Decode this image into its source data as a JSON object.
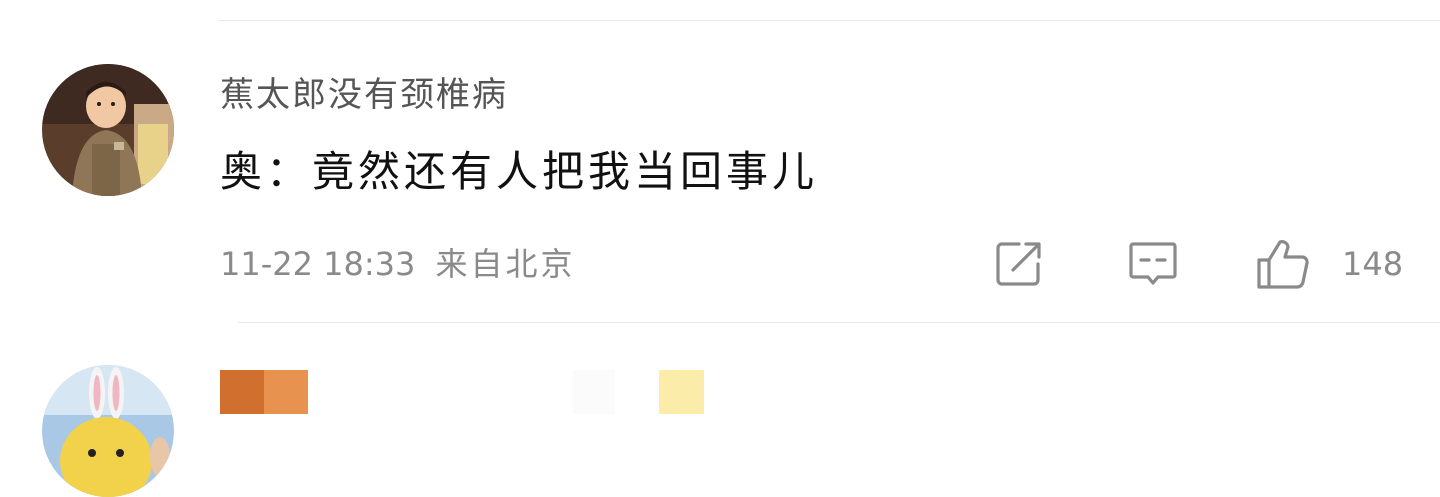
{
  "comments": [
    {
      "username": "蕉太郎没有颈椎病",
      "text": "奥：竟然还有人把我当回事儿",
      "time": "11-22 18:33",
      "location": "来自北京",
      "likes": "148",
      "icons": {
        "share": "share-icon",
        "reply": "comment-icon",
        "like": "thumbs-up-icon"
      }
    }
  ],
  "colors": {
    "username": "#555555",
    "text": "#111111",
    "meta": "#8a8a8a",
    "icon": "#8a8a8a",
    "divider": "#e8e8e8"
  }
}
